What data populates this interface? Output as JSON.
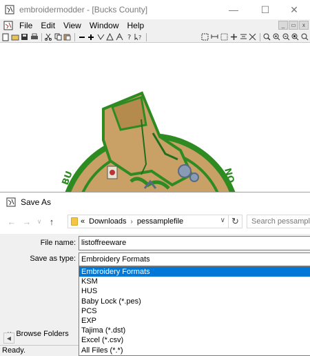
{
  "window": {
    "title": "embroidermodder - [Bucks County]",
    "minimize_icon": "minimize-icon",
    "maximize_icon": "maximize-icon",
    "close_icon": "close-icon"
  },
  "menu": [
    "File",
    "Edit",
    "View",
    "Window",
    "Help"
  ],
  "status": {
    "text": "Ready."
  },
  "dialog": {
    "title": "Save As",
    "breadcrumb": {
      "overflow": "«",
      "items": [
        "Downloads",
        "pessamplefile"
      ],
      "separator": "›"
    },
    "search": {
      "placeholder": "Search pessample"
    },
    "file_name": {
      "label": "File name:",
      "value": "listoffreeware"
    },
    "save_as_type": {
      "label": "Save as type:",
      "value": "Embroidery Formats",
      "options": [
        "Embroidery Formats",
        "KSM",
        "HUS",
        "Baby Lock (*.pes)",
        "PCS",
        "EXP",
        "Tajima (*.dst)",
        "Excel (*.csv)",
        "All Files (*.*)"
      ],
      "highlighted_index": 0
    },
    "browse_folders": "Browse Folders"
  },
  "design": {
    "text_left": "BU",
    "text_right": "NO",
    "colors": {
      "border_green": "#2e8b22",
      "tan": "#c9a167",
      "dark_green": "#1f6e1a",
      "grey_blue": "#8a9bb5"
    }
  },
  "colors": {
    "accent": "#0078d7",
    "panel": "#f0f0f0"
  }
}
